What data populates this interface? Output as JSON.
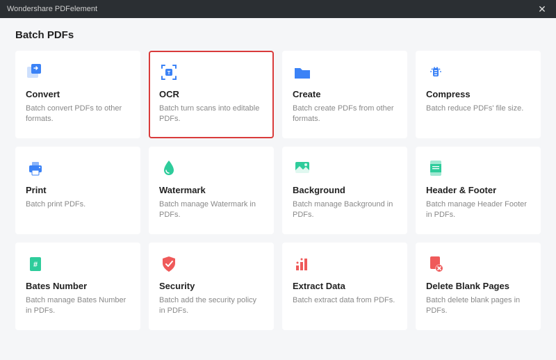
{
  "window": {
    "title": "Wondershare PDFelement",
    "close_glyph": "✕"
  },
  "page": {
    "title": "Batch PDFs"
  },
  "cards": [
    {
      "title": "Convert",
      "desc": "Batch convert PDFs to other formats.",
      "icon": "convert-icon",
      "color": "#3b82f6",
      "highlighted": false
    },
    {
      "title": "OCR",
      "desc": "Batch turn scans into editable PDFs.",
      "icon": "ocr-icon",
      "color": "#3b82f6",
      "highlighted": true
    },
    {
      "title": "Create",
      "desc": "Batch create PDFs from other formats.",
      "icon": "create-icon",
      "color": "#3b82f6",
      "highlighted": false
    },
    {
      "title": "Compress",
      "desc": "Batch reduce PDFs' file size.",
      "icon": "compress-icon",
      "color": "#3b82f6",
      "highlighted": false
    },
    {
      "title": "Print",
      "desc": "Batch print PDFs.",
      "icon": "print-icon",
      "color": "#3b82f6",
      "highlighted": false
    },
    {
      "title": "Watermark",
      "desc": "Batch manage Watermark in PDFs.",
      "icon": "watermark-icon",
      "color": "#2ecc9b",
      "highlighted": false
    },
    {
      "title": "Background",
      "desc": "Batch manage Background in PDFs.",
      "icon": "background-icon",
      "color": "#2ecc9b",
      "highlighted": false
    },
    {
      "title": "Header & Footer",
      "desc": "Batch manage Header Footer in PDFs.",
      "icon": "header-footer-icon",
      "color": "#2ecc9b",
      "highlighted": false
    },
    {
      "title": "Bates Number",
      "desc": "Batch manage Bates Number in PDFs.",
      "icon": "bates-number-icon",
      "color": "#2ecc9b",
      "highlighted": false
    },
    {
      "title": "Security",
      "desc": "Batch add the security policy in PDFs.",
      "icon": "security-icon",
      "color": "#ef5a5a",
      "highlighted": false
    },
    {
      "title": "Extract Data",
      "desc": "Batch extract data from PDFs.",
      "icon": "extract-data-icon",
      "color": "#ef5a5a",
      "highlighted": false
    },
    {
      "title": "Delete Blank Pages",
      "desc": "Batch delete blank pages in PDFs.",
      "icon": "delete-blank-icon",
      "color": "#ef5a5a",
      "highlighted": false
    }
  ]
}
